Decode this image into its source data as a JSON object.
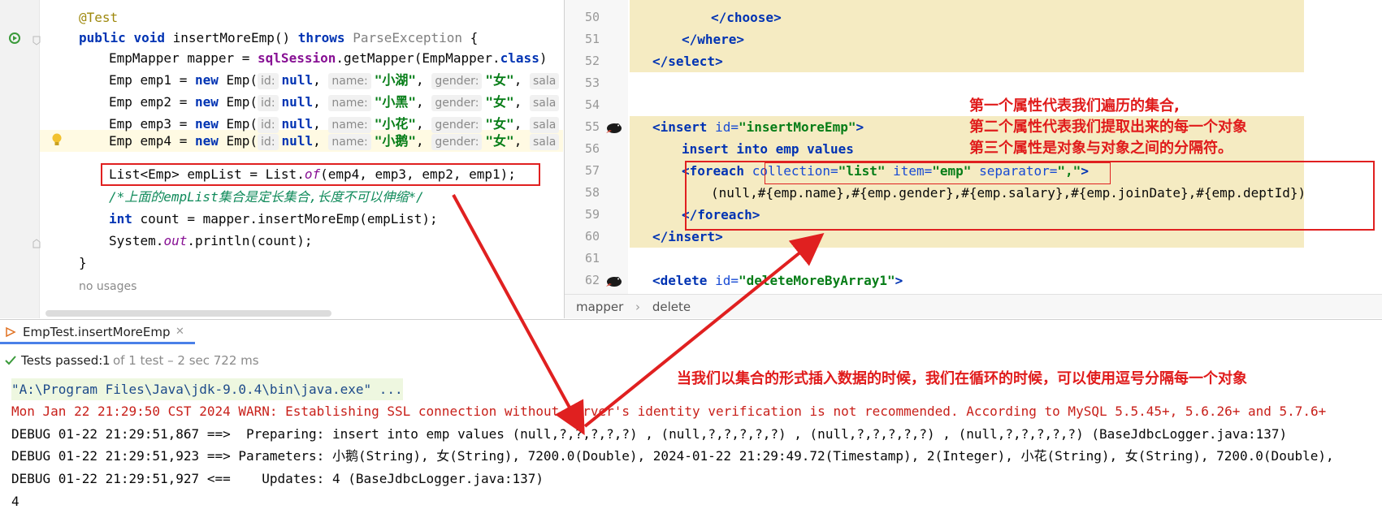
{
  "left_editor": {
    "lines": [
      {
        "type": "anno",
        "text": "@Test"
      },
      {
        "type": "method",
        "kw1": "public",
        "kw2": "void",
        "name": "insertMoreEmp()",
        "kw3": "throws",
        "exc": "ParseException",
        "brace": " {"
      },
      {
        "type": "mapper",
        "a": "EmpMapper mapper = ",
        "field": "sqlSession",
        "b": ".getMapper(EmpMapper.",
        "kw": "class",
        "c": ")"
      },
      {
        "type": "emp",
        "decl": "Emp emp1 = ",
        "kw": "new",
        "ctor": " Emp(",
        "h_id": "id:",
        "v_id": "null",
        "h_name": "name:",
        "v_name": "\"小湖\"",
        "h_gender": "gender:",
        "v_gender": "\"女\"",
        "h_sal": "sala"
      },
      {
        "type": "emp",
        "decl": "Emp emp2 = ",
        "kw": "new",
        "ctor": " Emp(",
        "h_id": "id:",
        "v_id": "null",
        "h_name": "name:",
        "v_name": "\"小黑\"",
        "h_gender": "gender:",
        "v_gender": "\"女\"",
        "h_sal": "sala"
      },
      {
        "type": "emp",
        "decl": "Emp emp3 = ",
        "kw": "new",
        "ctor": " Emp(",
        "h_id": "id:",
        "v_id": "null",
        "h_name": "name:",
        "v_name": "\"小花\"",
        "h_gender": "gender:",
        "v_gender": "\"女\"",
        "h_sal": "sala"
      },
      {
        "type": "emp",
        "decl": "Emp emp4 = ",
        "kw": "new",
        "ctor": " Emp(",
        "h_id": "id:",
        "v_id": "null",
        "h_name": "name:",
        "v_name": "\"小鹅\"",
        "h_gender": "gender:",
        "v_gender": "\"女\"",
        "h_sal": "sala"
      },
      {
        "type": "list",
        "a": "List<Emp> empList = List.",
        "ital": "of",
        "b": "(emp4, emp3, emp2, emp1);"
      },
      {
        "type": "comment",
        "text": "/*上面的empList集合是定长集合,长度不可以伸缩*/"
      },
      {
        "type": "count",
        "kw": "int",
        "a": " count = mapper.insertMoreEmp(empList);"
      },
      {
        "type": "print",
        "a": "System.",
        "ital": "out",
        "b": ".println(count);"
      },
      {
        "type": "brace",
        "text": "}"
      }
    ],
    "usages": "no usages"
  },
  "right_editor": {
    "line_numbers": [
      "50",
      "51",
      "52",
      "53",
      "54",
      "55",
      "56",
      "57",
      "58",
      "59",
      "60",
      "61",
      "62"
    ],
    "code": {
      "l50": "</choose>",
      "l51": "</where>",
      "l52": "</select>",
      "l55_tag": "<insert ",
      "l55_attr": "id=",
      "l55_val": "\"insertMoreEmp\"",
      "l55_end": ">",
      "l56": "insert into emp values",
      "l57_tag": "<foreach ",
      "l57_a1": "collection=",
      "l57_v1": "\"list\"",
      "l57_a2": " item=",
      "l57_v2": "\"emp\"",
      "l57_a3": " separator=",
      "l57_v3": "\",\"",
      "l57_end": ">",
      "l58": "(null,#{emp.name},#{emp.gender},#{emp.salary},#{emp.joinDate},#{emp.deptId})",
      "l59": "</foreach>",
      "l60": "</insert>",
      "l62_tag": "<delete ",
      "l62_attr": "id=",
      "l62_val": "\"deleteMoreByArray1\"",
      "l62_end": ">"
    },
    "annotation_lines": [
      "第一个属性代表我们遍历的集合,",
      "第二个属性代表我们提取出来的每一个对象",
      "第三个属性是对象与对象之间的分隔符。"
    ],
    "breadcrumb": [
      "mapper",
      "delete"
    ]
  },
  "run_panel": {
    "tab_label": "EmpTest.insertMoreEmp",
    "tests_passed_label": "Tests passed:",
    "tests_passed_count": "1",
    "tests_passed_rest": "of 1 test – 2 sec 722 ms",
    "bottom_annotation": "当我们以集合的形式插入数据的时候，我们在循环的时候，可以使用逗号分隔每一个对象",
    "console_lines": [
      "\"A:\\Program Files\\Java\\jdk-9.0.4\\bin\\java.exe\" ...",
      "Mon Jan 22 21:29:50 CST 2024 WARN: Establishing SSL connection without server's identity verification is not recommended. According to MySQL 5.5.45+, 5.6.26+ and 5.7.6+",
      "DEBUG 01-22 21:29:51,867 ==>  Preparing: insert into emp values (null,?,?,?,?,?) , (null,?,?,?,?,?) , (null,?,?,?,?,?) , (null,?,?,?,?,?) (BaseJdbcLogger.java:137)",
      "DEBUG 01-22 21:29:51,923 ==> Parameters: 小鹅(String), 女(String), 7200.0(Double), 2024-01-22 21:29:49.72(Timestamp), 2(Integer), 小花(String), 女(String), 7200.0(Double),",
      "DEBUG 01-22 21:29:51,927 <==    Updates: 4 (BaseJdbcLogger.java:137)",
      "4"
    ]
  },
  "colors": {
    "annotation_red": "#e02020",
    "xml_highlight": "#f5ebc2",
    "keyword_blue": "#0033b3",
    "string_green": "#067d17"
  }
}
